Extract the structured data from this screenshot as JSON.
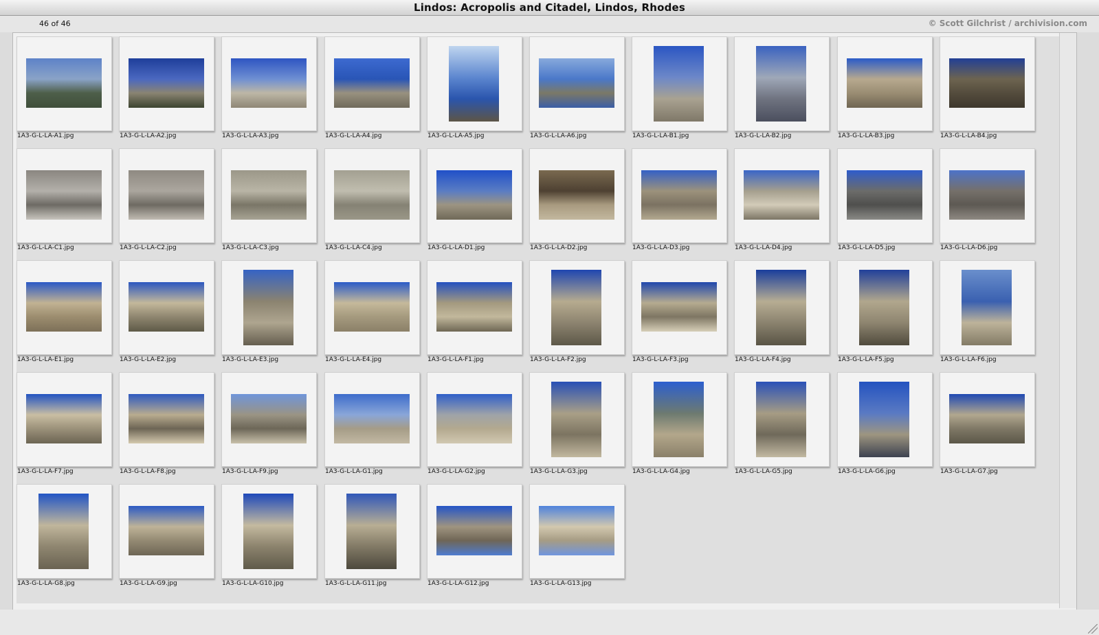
{
  "window": {
    "title": "Lindos: Acropolis and Citadel, Lindos, Rhodes",
    "counter": "46 of 46",
    "credit": "© Scott Gilchrist / archivision.com"
  },
  "thumbnails": [
    {
      "label": "1A3-G-L-LA-A1.jpg",
      "orientation": "land",
      "colors": [
        "#5d82c8",
        "#8aa3c7",
        "#4e5f4a",
        "#3f4e3a"
      ]
    },
    {
      "label": "1A3-G-L-LA-A2.jpg",
      "orientation": "land",
      "colors": [
        "#1e3e9a",
        "#4b68c0",
        "#8a8472",
        "#3c4430"
      ]
    },
    {
      "label": "1A3-G-L-LA-A3.jpg",
      "orientation": "land",
      "colors": [
        "#2e55c2",
        "#6f8fd2",
        "#bdb7a6",
        "#8e8675"
      ]
    },
    {
      "label": "1A3-G-L-LA-A4.jpg",
      "orientation": "land",
      "colors": [
        "#3d6ad0",
        "#2955b6",
        "#98917f",
        "#706a5b"
      ]
    },
    {
      "label": "1A3-G-L-LA-A5.jpg",
      "orientation": "port",
      "colors": [
        "#bfd5ef",
        "#5c86cf",
        "#2a55ad",
        "#5d5546"
      ]
    },
    {
      "label": "1A3-G-L-LA-A6.jpg",
      "orientation": "land",
      "colors": [
        "#87a9dc",
        "#4a78c9",
        "#7b7967",
        "#3a5da6"
      ]
    },
    {
      "label": "1A3-G-L-LA-B1.jpg",
      "orientation": "port",
      "colors": [
        "#2b56c3",
        "#6d88c8",
        "#a9a291",
        "#7f7868"
      ]
    },
    {
      "label": "1A3-G-L-LA-B2.jpg",
      "orientation": "port",
      "colors": [
        "#3a62c0",
        "#9fa8b8",
        "#6f7380",
        "#4b4f5e"
      ]
    },
    {
      "label": "1A3-G-L-LA-B3.jpg",
      "orientation": "land",
      "colors": [
        "#2a5bc8",
        "#b7a98f",
        "#9a8d73",
        "#6f6552"
      ]
    },
    {
      "label": "1A3-G-L-LA-B4.jpg",
      "orientation": "land",
      "colors": [
        "#223f95",
        "#6d6450",
        "#544c3d",
        "#3e382d"
      ]
    },
    {
      "label": "1A3-G-L-LA-C1.jpg",
      "orientation": "land",
      "colors": [
        "#8a8680",
        "#b3b0aa",
        "#6d6a64",
        "#c8c5be"
      ]
    },
    {
      "label": "1A3-G-L-LA-C2.jpg",
      "orientation": "land",
      "colors": [
        "#8f8a82",
        "#aba69e",
        "#6e6a62",
        "#c1bcb3"
      ]
    },
    {
      "label": "1A3-G-L-LA-C3.jpg",
      "orientation": "land",
      "colors": [
        "#9b9788",
        "#b9b5a6",
        "#7a7667",
        "#a7a394"
      ]
    },
    {
      "label": "1A3-G-L-LA-C4.jpg",
      "orientation": "land",
      "colors": [
        "#a3a091",
        "#c0bdaf",
        "#858274",
        "#9a9788"
      ]
    },
    {
      "label": "1A3-G-L-LA-D1.jpg",
      "orientation": "land",
      "colors": [
        "#2050c8",
        "#5a7cc3",
        "#9c9482",
        "#706958"
      ]
    },
    {
      "label": "1A3-G-L-LA-D2.jpg",
      "orientation": "land",
      "colors": [
        "#7a6a50",
        "#4e4132",
        "#a89a7f",
        "#c3b89f"
      ]
    },
    {
      "label": "1A3-G-L-LA-D3.jpg",
      "orientation": "land",
      "colors": [
        "#3460c6",
        "#9c927c",
        "#7b7262",
        "#b3a990"
      ]
    },
    {
      "label": "1A3-G-L-LA-D4.jpg",
      "orientation": "land",
      "colors": [
        "#3a66c8",
        "#a59f8e",
        "#d2cbb8",
        "#7c7565"
      ]
    },
    {
      "label": "1A3-G-L-LA-D5.jpg",
      "orientation": "land",
      "colors": [
        "#2e5ccc",
        "#6c6c6a",
        "#4f4f4d",
        "#8a8a86"
      ]
    },
    {
      "label": "1A3-G-L-LA-D6.jpg",
      "orientation": "land",
      "colors": [
        "#4d73c9",
        "#75706a",
        "#5d5953",
        "#8e8982"
      ]
    },
    {
      "label": "1A3-G-L-LA-E1.jpg",
      "orientation": "land",
      "colors": [
        "#2a59c6",
        "#c1b293",
        "#9c8d6f",
        "#7d7058"
      ]
    },
    {
      "label": "1A3-G-L-LA-E2.jpg",
      "orientation": "land",
      "colors": [
        "#2b57c0",
        "#c3b89b",
        "#8f8670",
        "#5e5a47"
      ]
    },
    {
      "label": "1A3-G-L-LA-E3.jpg",
      "orientation": "port",
      "colors": [
        "#3563c5",
        "#8b8370",
        "#aea58f",
        "#655e4f"
      ]
    },
    {
      "label": "1A3-G-L-LA-E4.jpg",
      "orientation": "land",
      "colors": [
        "#2a5bc8",
        "#c5b99b",
        "#a59a7e",
        "#8b8068"
      ]
    },
    {
      "label": "1A3-G-L-LA-F1.jpg",
      "orientation": "land",
      "colors": [
        "#2451c0",
        "#a3997f",
        "#c2b89c",
        "#6e6754"
      ]
    },
    {
      "label": "1A3-G-L-LA-F2.jpg",
      "orientation": "port",
      "colors": [
        "#1f46b0",
        "#b6ab8f",
        "#8d8470",
        "#5d5848"
      ]
    },
    {
      "label": "1A3-G-L-LA-F3.jpg",
      "orientation": "land",
      "colors": [
        "#1f47ad",
        "#b5ab90",
        "#7e7663",
        "#d6ceb7"
      ]
    },
    {
      "label": "1A3-G-L-LA-F4.jpg",
      "orientation": "port",
      "colors": [
        "#1a3e9c",
        "#b7ad93",
        "#8b836f",
        "#595445"
      ]
    },
    {
      "label": "1A3-G-L-LA-F5.jpg",
      "orientation": "port",
      "colors": [
        "#21409a",
        "#b1a78d",
        "#8e8570",
        "#504b3d"
      ]
    },
    {
      "label": "1A3-G-L-LA-F6.jpg",
      "orientation": "port",
      "colors": [
        "#6a8fcc",
        "#3a60b0",
        "#bdb39a",
        "#837b66"
      ]
    },
    {
      "label": "1A3-G-L-LA-F7.jpg",
      "orientation": "land",
      "colors": [
        "#2253c2",
        "#c9bea3",
        "#9b917a",
        "#6c6553"
      ]
    },
    {
      "label": "1A3-G-L-LA-F8.jpg",
      "orientation": "land",
      "colors": [
        "#2e5ac0",
        "#b9ac8f",
        "#6d6555",
        "#d4c9ae"
      ]
    },
    {
      "label": "1A3-G-L-LA-F9.jpg",
      "orientation": "land",
      "colors": [
        "#6f95da",
        "#9a9484",
        "#6d6758",
        "#c8c0aa"
      ]
    },
    {
      "label": "1A3-G-L-LA-G1.jpg",
      "orientation": "land",
      "colors": [
        "#3d6ccb",
        "#8aa6d8",
        "#a59c87",
        "#c2b9a3"
      ]
    },
    {
      "label": "1A3-G-L-LA-G2.jpg",
      "orientation": "land",
      "colors": [
        "#2f5fc9",
        "#9fa3a8",
        "#b3a98f",
        "#d1c8b1"
      ]
    },
    {
      "label": "1A3-G-L-LA-G3.jpg",
      "orientation": "port",
      "colors": [
        "#2850b6",
        "#a99f87",
        "#7c7461",
        "#c2b89f"
      ]
    },
    {
      "label": "1A3-G-L-LA-G4.jpg",
      "orientation": "port",
      "colors": [
        "#2c5fcf",
        "#6d7a70",
        "#b3a78b",
        "#8a806a"
      ]
    },
    {
      "label": "1A3-G-L-LA-G5.jpg",
      "orientation": "port",
      "colors": [
        "#2a51b8",
        "#a69c84",
        "#6f695a",
        "#c2b9a2"
      ]
    },
    {
      "label": "1A3-G-L-LA-G6.jpg",
      "orientation": "port",
      "colors": [
        "#2453c0",
        "#5a7ac3",
        "#9d9580",
        "#3d4250"
      ]
    },
    {
      "label": "1A3-G-L-LA-G7.jpg",
      "orientation": "land",
      "colors": [
        "#1f49b3",
        "#b1a78e",
        "#7f7866",
        "#5b5748"
      ]
    },
    {
      "label": "1A3-G-L-LA-G8.jpg",
      "orientation": "port",
      "colors": [
        "#2255c5",
        "#c0b69c",
        "#8f8670",
        "#6a6352"
      ]
    },
    {
      "label": "1A3-G-L-LA-G9.jpg",
      "orientation": "land",
      "colors": [
        "#2c5ac4",
        "#beb398",
        "#948a73",
        "#6e6655"
      ]
    },
    {
      "label": "1A3-G-L-LA-G10.jpg",
      "orientation": "port",
      "colors": [
        "#1e49ba",
        "#c4baa0",
        "#8c836d",
        "#5f5a4a"
      ]
    },
    {
      "label": "1A3-G-L-LA-G11.jpg",
      "orientation": "port",
      "colors": [
        "#3057b9",
        "#b8ae94",
        "#827a66",
        "#4d493d"
      ]
    },
    {
      "label": "1A3-G-L-LA-G12.jpg",
      "orientation": "land",
      "colors": [
        "#2455c6",
        "#9f9480",
        "#6f6656",
        "#4e7bd0"
      ]
    },
    {
      "label": "1A3-G-L-LA-G13.jpg",
      "orientation": "land",
      "colors": [
        "#4f83dc",
        "#d2c8af",
        "#a69c84",
        "#6f95df"
      ]
    }
  ]
}
